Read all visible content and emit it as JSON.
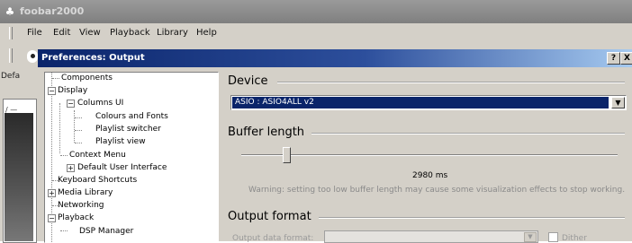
{
  "app": {
    "title": "foobar2000",
    "menu": [
      "File",
      "Edit",
      "View",
      "Playback",
      "Library",
      "Help"
    ],
    "left_tab_label": "Defa"
  },
  "dialog": {
    "title": "Preferences: Output",
    "help_button": "?",
    "close_button": "X"
  },
  "tree": {
    "items": [
      "Components",
      "Display",
      "Columns UI",
      "Colours and Fonts",
      "Playlist switcher",
      "Playlist view",
      "Context Menu",
      "Default User Interface",
      "Keyboard Shortcuts",
      "Media Library",
      "Networking",
      "Playback",
      "DSP Manager"
    ],
    "expanders": [
      "−",
      "−",
      "+",
      "+",
      "−"
    ]
  },
  "device": {
    "heading": "Device",
    "value": "ASIO : ASIO4ALL v2"
  },
  "buffer": {
    "heading": "Buffer length",
    "value_text": "2980 ms",
    "slider_fraction": 0.12,
    "warning": "Warning: setting too low buffer length may cause some visualization effects to stop working."
  },
  "output_format": {
    "heading": "Output format",
    "label": "Output data format:",
    "value": "",
    "dither_label": "Dither",
    "dither_checked": false
  },
  "icons": {
    "dropdown": "▼"
  }
}
